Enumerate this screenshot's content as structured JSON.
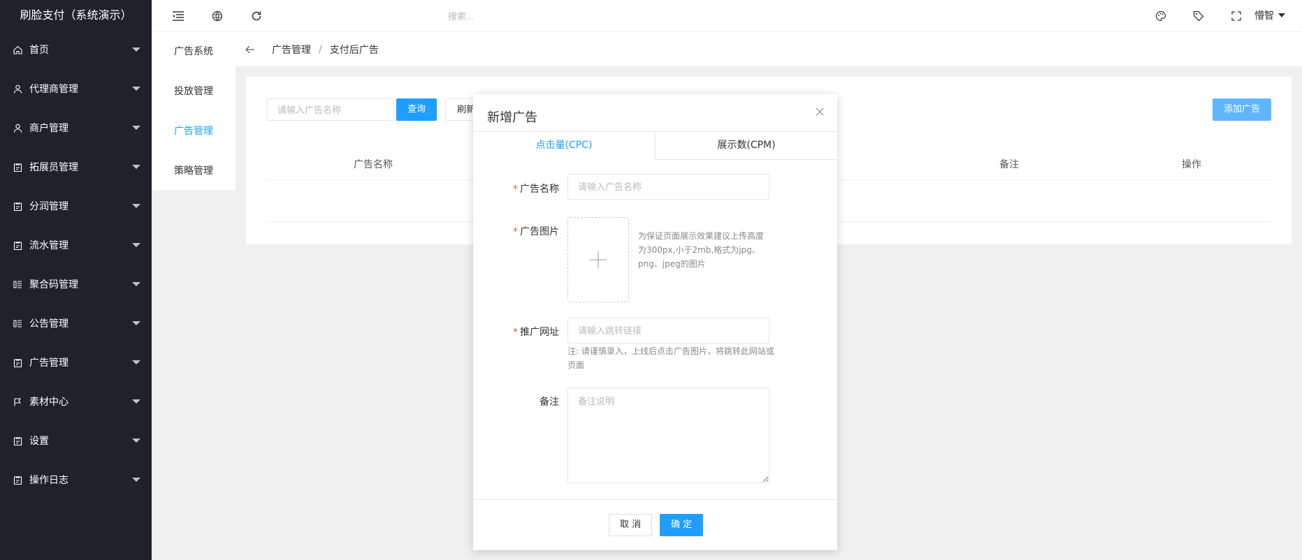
{
  "app": {
    "brand": "刷脸支付（系统演示）"
  },
  "sidebar": {
    "items": [
      {
        "label": "首页",
        "icon": "home-icon"
      },
      {
        "label": "代理商管理",
        "icon": "user-icon"
      },
      {
        "label": "商户管理",
        "icon": "user-icon"
      },
      {
        "label": "拓展员管理",
        "icon": "clipboard-icon"
      },
      {
        "label": "分润管理",
        "icon": "clipboard-icon"
      },
      {
        "label": "流水管理",
        "icon": "clipboard-icon"
      },
      {
        "label": "聚合码管理",
        "icon": "list-icon"
      },
      {
        "label": "公告管理",
        "icon": "list-icon"
      },
      {
        "label": "广告管理",
        "icon": "clipboard-icon"
      },
      {
        "label": "素材中心",
        "icon": "flag-icon"
      },
      {
        "label": "设置",
        "icon": "clipboard-icon"
      },
      {
        "label": "操作日志",
        "icon": "clipboard-icon"
      }
    ]
  },
  "header": {
    "search_placeholder": "搜索...",
    "user_name": "懵智"
  },
  "submenu": {
    "items": [
      {
        "label": "广告系统",
        "active": false
      },
      {
        "label": "投放管理",
        "active": false
      },
      {
        "label": "广告管理",
        "active": true
      },
      {
        "label": "策略管理",
        "active": false
      }
    ]
  },
  "breadcrumb": {
    "items": [
      "广告管理",
      "支付后广告"
    ],
    "separator": "/"
  },
  "card": {
    "search_placeholder": "请输入广告名称",
    "query_label": "查询",
    "refresh_label": "刷新",
    "add_label": "添加广告",
    "columns": [
      "广告名称",
      "备注",
      "操作"
    ]
  },
  "modal": {
    "title": "新增广告",
    "tabs": [
      {
        "label": "点击量(CPC)",
        "active": true
      },
      {
        "label": "展示数(CPM)",
        "active": false
      }
    ],
    "fields": {
      "name_label": "广告名称",
      "name_placeholder": "请输入广告名称",
      "image_label": "广告图片",
      "image_hint": "为保证页面展示效果建议上传高度为300px,小于2mb,格式为jpg、png、jpeg的图片",
      "url_label": "推广网址",
      "url_placeholder": "请输入跳转链接",
      "url_note": "注: 请谨慎录入，上线后点击广告图片，将跳转此网站或页面",
      "remark_label": "备注",
      "remark_placeholder": "备注说明"
    },
    "cancel_label": "取 消",
    "confirm_label": "确 定"
  },
  "colors": {
    "sidebar_bg": "#20222a",
    "primary": "#1e9fff",
    "required": "#ff5722"
  }
}
